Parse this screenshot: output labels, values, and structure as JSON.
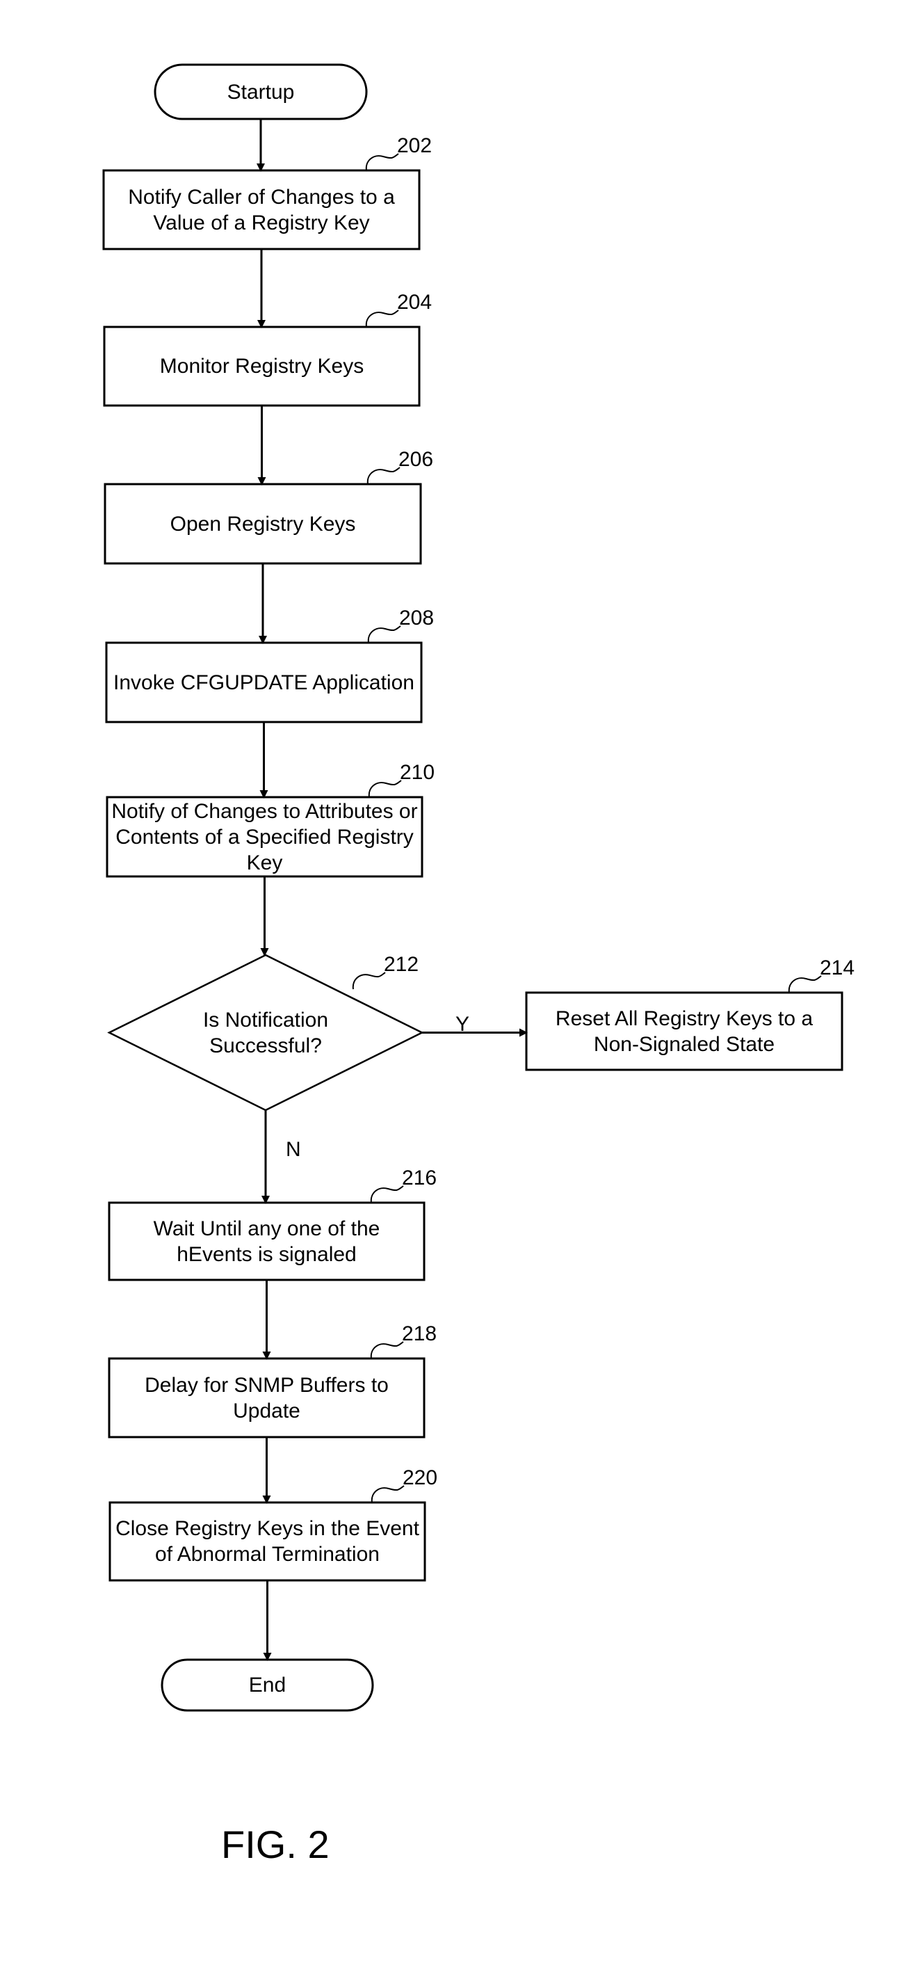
{
  "figure": {
    "caption": "FIG. 2",
    "line_color": "#000000",
    "background": "#ffffff"
  },
  "nodes": [
    {
      "id": "start",
      "type": "terminal",
      "text": "Startup",
      "ref": ""
    },
    {
      "id": "202",
      "type": "process",
      "text": "Notify Caller of Changes to a Value of a Registry Key",
      "ref": "202"
    },
    {
      "id": "204",
      "type": "process",
      "text": "Monitor Registry Keys",
      "ref": "204"
    },
    {
      "id": "206",
      "type": "process",
      "text": "Open Registry Keys",
      "ref": "206"
    },
    {
      "id": "208",
      "type": "process",
      "text": "Invoke CFGUPDATE Application",
      "ref": "208"
    },
    {
      "id": "210",
      "type": "process",
      "text": "Notify of Changes to Attributes or Contents of a Specified Registry Key",
      "ref": "210"
    },
    {
      "id": "212",
      "type": "decision",
      "text": "Is Notification Successful?",
      "ref": "212"
    },
    {
      "id": "214",
      "type": "process",
      "text": "Reset All Registry Keys to a Non-Signaled State",
      "ref": "214"
    },
    {
      "id": "216",
      "type": "process",
      "text": "Wait Until any one of the hEvents is signaled",
      "ref": "216"
    },
    {
      "id": "218",
      "type": "process",
      "text": "Delay for SNMP Buffers to Update",
      "ref": "218"
    },
    {
      "id": "220",
      "type": "process",
      "text": "Close Registry Keys in the Event of Abnormal Termination",
      "ref": "220"
    },
    {
      "id": "end",
      "type": "terminal",
      "text": "End",
      "ref": ""
    }
  ],
  "edges": [
    {
      "from": "start",
      "to": "202",
      "label": ""
    },
    {
      "from": "202",
      "to": "204",
      "label": ""
    },
    {
      "from": "204",
      "to": "206",
      "label": ""
    },
    {
      "from": "206",
      "to": "208",
      "label": ""
    },
    {
      "from": "208",
      "to": "210",
      "label": ""
    },
    {
      "from": "210",
      "to": "212",
      "label": ""
    },
    {
      "from": "212",
      "to": "214",
      "label": "Y"
    },
    {
      "from": "212",
      "to": "216",
      "label": "N"
    },
    {
      "from": "216",
      "to": "218",
      "label": ""
    },
    {
      "from": "218",
      "to": "220",
      "label": ""
    },
    {
      "from": "220",
      "to": "end",
      "label": ""
    }
  ]
}
